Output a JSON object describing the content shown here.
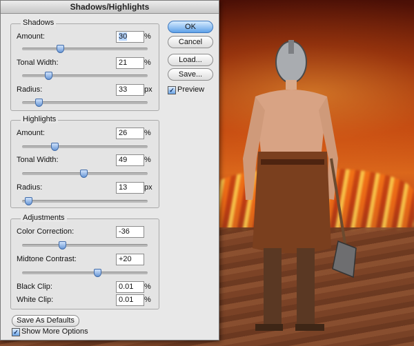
{
  "dialog": {
    "title": "Shadows/Highlights",
    "ok_label": "OK",
    "cancel_label": "Cancel",
    "load_label": "Load...",
    "save_label": "Save...",
    "preview_label": "Preview",
    "preview_checked": true,
    "save_defaults_label": "Save As Defaults",
    "more_options_label": "Show More Options",
    "more_options_checked": true
  },
  "shadows": {
    "title": "Shadows",
    "amount": {
      "label": "Amount:",
      "value": "30",
      "unit": "%"
    },
    "tonal_width": {
      "label": "Tonal Width:",
      "value": "21",
      "unit": "%"
    },
    "radius": {
      "label": "Radius:",
      "value": "33",
      "unit": "px"
    }
  },
  "highlights": {
    "title": "Highlights",
    "amount": {
      "label": "Amount:",
      "value": "26",
      "unit": "%"
    },
    "tonal_width": {
      "label": "Tonal Width:",
      "value": "49",
      "unit": "%"
    },
    "radius": {
      "label": "Radius:",
      "value": "13",
      "unit": "px"
    }
  },
  "adjustments": {
    "title": "Adjustments",
    "color_correction": {
      "label": "Color Correction:",
      "value": "-36"
    },
    "midtone_contrast": {
      "label": "Midtone Contrast:",
      "value": "+20"
    },
    "black_clip": {
      "label": "Black Clip:",
      "value": "0.01",
      "unit": "%"
    },
    "white_clip": {
      "label": "White Clip:",
      "value": "0.01",
      "unit": "%"
    }
  },
  "sliders": {
    "shadows_amount": 0.3,
    "shadows_tonal_width": 0.21,
    "shadows_radius": 0.13,
    "highlights_amount": 0.26,
    "highlights_tonal_width": 0.49,
    "highlights_radius": 0.05,
    "color_correction": 0.32,
    "midtone_contrast": 0.6
  },
  "colors": {
    "accent": "#5ea1e8",
    "dialog_bg": "#e8e8e8"
  }
}
